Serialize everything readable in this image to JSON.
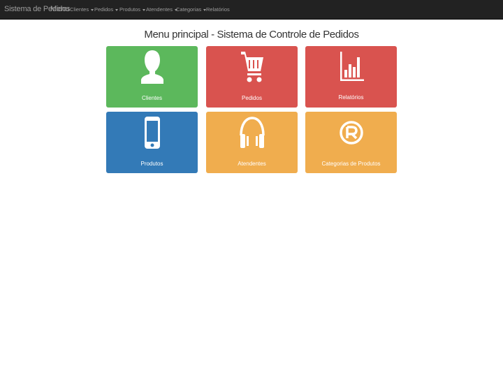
{
  "navbar": {
    "brand": "Sistema de Pedidos",
    "menu_label": "Menu",
    "items": [
      {
        "label": "Clientes",
        "dropdown": true
      },
      {
        "label": "Pedidos",
        "dropdown": true
      },
      {
        "label": "Produtos",
        "dropdown": true
      },
      {
        "label": "Atendentes",
        "dropdown": true
      },
      {
        "label": "Categorias",
        "dropdown": true
      },
      {
        "label": "Relatórios",
        "dropdown": false
      }
    ]
  },
  "main": {
    "title": "Menu principal - Sistema de Controle de Pedidos",
    "tiles": [
      {
        "label": "Clientes",
        "icon": "user-icon",
        "color": "#5cb85c"
      },
      {
        "label": "Pedidos",
        "icon": "cart-icon",
        "color": "#d9534f"
      },
      {
        "label": "Relatórios",
        "icon": "bar-chart-icon",
        "color": "#d9534f"
      },
      {
        "label": "Produtos",
        "icon": "phone-icon",
        "color": "#337ab7"
      },
      {
        "label": "Atendentes",
        "icon": "headphones-icon",
        "color": "#f0ad4e"
      },
      {
        "label": "Categorias de Produtos",
        "icon": "registered-icon",
        "color": "#f0ad4e"
      }
    ]
  },
  "colors": {
    "navbar_bg": "#222222",
    "navbar_text": "#9d9d9d",
    "success": "#5cb85c",
    "danger": "#d9534f",
    "primary": "#337ab7",
    "warning": "#f0ad4e"
  }
}
